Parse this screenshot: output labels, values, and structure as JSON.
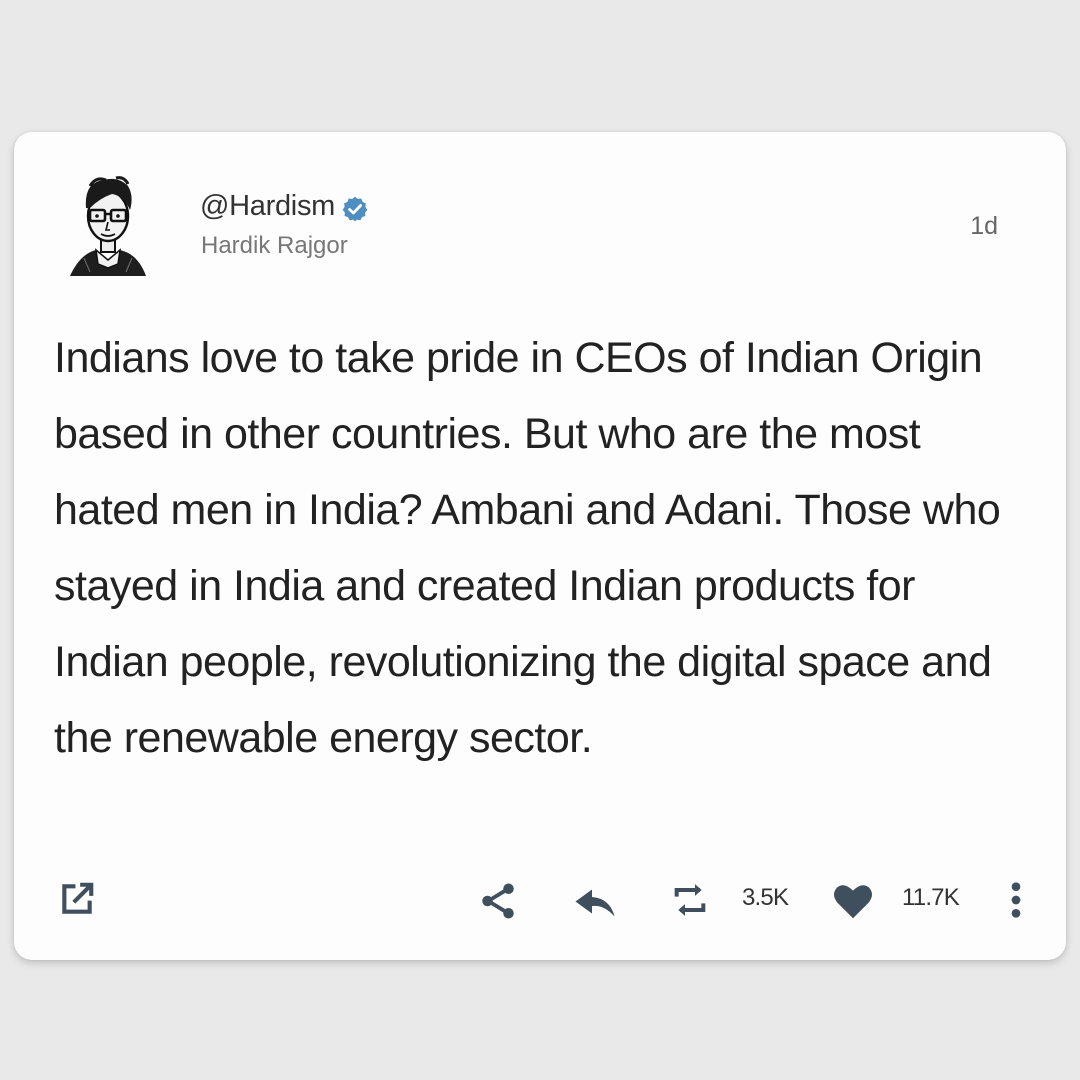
{
  "tweet": {
    "handle": "@Hardism",
    "display_name": "Hardik Rajgor",
    "time": "1d",
    "text": "Indians love to take pride in CEOs of Indian Origin based in other countries. But who are the most hated men in India? Ambani and Adani. Those who stayed in India and created Indian products for Indian people, revolutionizing the digital space and the renewable energy sector.",
    "verified": true
  },
  "actions": {
    "retweets": "3.5K",
    "likes": "11.7K"
  },
  "icons": {
    "open_external": "external-link-icon",
    "share": "share-icon",
    "reply": "reply-icon",
    "retweet": "retweet-icon",
    "like": "heart-icon",
    "more": "more-vertical-icon"
  },
  "colors": {
    "background": "#e9e9e9",
    "card": "#fdfdfd",
    "verified_badge": "#4f8ec0",
    "icon": "#3f4f5e"
  }
}
